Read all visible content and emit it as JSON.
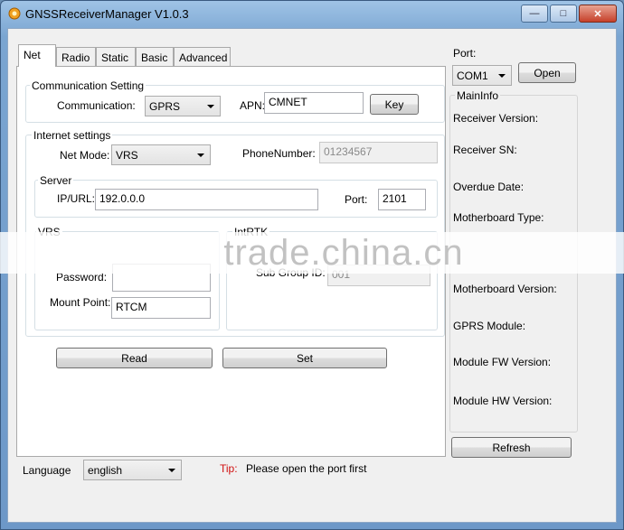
{
  "window": {
    "title": "GNSSReceiverManager V1.0.3"
  },
  "tabs": [
    "Net",
    "Radio",
    "Static",
    "Basic",
    "Advanced"
  ],
  "communication": {
    "group_label": "Communication Setting",
    "comm_label": "Communication:",
    "comm_value": "GPRS",
    "apn_label": "APN:",
    "apn_value": "CMNET",
    "key_button": "Key"
  },
  "internet": {
    "group_label": "Internet settings",
    "netmode_label": "Net Mode:",
    "netmode_value": "VRS",
    "phone_label": "PhoneNumber:",
    "phone_value": "01234567"
  },
  "server": {
    "group_label": "Server",
    "ip_label": "IP/URL:",
    "ip_value": "192.0.0.0",
    "port_label": "Port:",
    "port_value": "2101"
  },
  "vrs": {
    "group_label": "VRS",
    "password_label": "Password:",
    "password_value": "",
    "mountpoint_label": "Mount Point:",
    "mountpoint_value": "RTCM"
  },
  "intrtk": {
    "group_label": "IntRTK",
    "subgroup_label": "Sub Group ID:",
    "subgroup_value": "001"
  },
  "actions": {
    "read": "Read",
    "set": "Set"
  },
  "port_panel": {
    "label": "Port:",
    "value": "COM1",
    "open": "Open"
  },
  "maininfo": {
    "group_label": "MainInfo",
    "fields": [
      "Receiver Version:",
      "Receiver SN:",
      "Overdue Date:",
      "Motherboard Type:",
      "Motherboard Version:",
      "GPRS Module:",
      "Module FW Version:",
      "Module HW Version:"
    ],
    "refresh": "Refresh"
  },
  "footer": {
    "language_label": "Language",
    "language_value": "english",
    "tip_label": "Tip:",
    "tip_text": "Please open the port first"
  },
  "watermark": "trade.china.cn"
}
